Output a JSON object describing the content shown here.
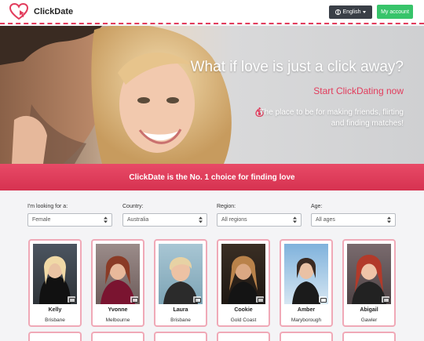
{
  "brand": {
    "name": "ClickDate",
    "logo_icon": "heart-logo-icon",
    "accent": "#e23c5c"
  },
  "nav": {
    "language_label": "English",
    "language_icon": "globe-icon",
    "account_label": "My account",
    "account_color": "#37c46a"
  },
  "hero": {
    "headline": "What if love is just a click away?",
    "cta": "Start ClickDating now",
    "tagline": "The place to be for making friends, flirting and finding matches!",
    "tagline_icon": "flame-icon"
  },
  "banner": {
    "text": "ClickDate is the No. 1 choice for finding love",
    "color": "#e0405e"
  },
  "filters": {
    "looking_for": {
      "label": "I'm looking for a:",
      "value": "Female"
    },
    "country": {
      "label": "Country:",
      "value": "Australia"
    },
    "region": {
      "label": "Region:",
      "value": "All regions"
    },
    "age": {
      "label": "Age:",
      "value": "All ages"
    }
  },
  "profiles": [
    {
      "name": "Kelly",
      "city": "Brisbane"
    },
    {
      "name": "Yvonne",
      "city": "Melbourne"
    },
    {
      "name": "Laura",
      "city": "Brisbane"
    },
    {
      "name": "Cookie",
      "city": "Gold Coast"
    },
    {
      "name": "Amber",
      "city": "Maryborough"
    },
    {
      "name": "Abigail",
      "city": "Gawler"
    }
  ]
}
